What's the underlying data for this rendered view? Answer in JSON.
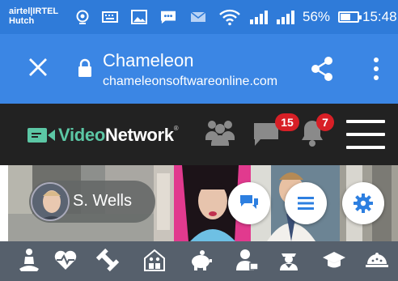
{
  "status_bar": {
    "carrier_line1": "airtel|IRTEL",
    "carrier_line2": "Hutch",
    "battery_percent": "56%",
    "battery_level": 0.56,
    "time": "15:48"
  },
  "browser": {
    "page_title": "Chameleon",
    "url": "chameleonsoftwareonline.com"
  },
  "site_header": {
    "logo_part1": "Video",
    "logo_part2": "Network",
    "logo_tm": "®",
    "messages_badge": "15",
    "notifications_badge": "7"
  },
  "banner": {
    "user_name": "S. Wells"
  },
  "categories": [
    {
      "icon": "meditation-icon"
    },
    {
      "icon": "heart-pulse-icon"
    },
    {
      "icon": "dumbbell-icon"
    },
    {
      "icon": "family-home-icon"
    },
    {
      "icon": "piggy-bank-icon"
    },
    {
      "icon": "business-user-icon"
    },
    {
      "icon": "officer-icon"
    },
    {
      "icon": "graduation-cap-icon"
    },
    {
      "icon": "food-platter-icon"
    }
  ],
  "colors": {
    "status_bar": "#2f7bd9",
    "browser_bar": "#3b86e4",
    "site_header": "#222222",
    "badge": "#d81f26",
    "logo_accent": "#5cc7a5",
    "category_bar": "#56606c",
    "fab_icon": "#2d7fe0"
  }
}
